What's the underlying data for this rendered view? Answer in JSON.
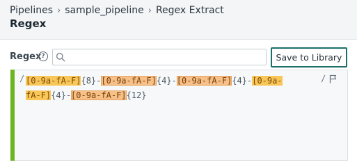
{
  "breadcrumb": {
    "items": [
      "Pipelines",
      "sample_pipeline",
      "Regex Extract"
    ],
    "separator": "›"
  },
  "page": {
    "title": "Regex"
  },
  "regex_field": {
    "label": "Regex",
    "help_glyph": "?",
    "search_value": "",
    "search_placeholder": ""
  },
  "toolbar": {
    "save_label": "Save to Library"
  },
  "editor": {
    "open_delimiter": "/",
    "close_delimiter": "/",
    "line1": {
      "t1": "[0-9a-fA-F]",
      "t2": "{8}",
      "t3": "-",
      "t4": "[0-9a-fA-F]",
      "t5": "{4}",
      "t6": "-",
      "t7": "[0-9a-fA-F]",
      "t8": "{4}",
      "t9": "-",
      "t10": "[0-9a-"
    },
    "line2": {
      "t1": "fA-F]",
      "t2": "{4}",
      "t3": "-",
      "t4": "[0-9a-fA-F]",
      "t5": "{12}"
    }
  },
  "colors": {
    "accent_button_border": "#1b6f6a",
    "editor_valid_bar": "#6cb520",
    "char_class_highlight": "#f6c08a"
  },
  "icons": [
    "help-icon",
    "search-icon",
    "flag-icon"
  ]
}
